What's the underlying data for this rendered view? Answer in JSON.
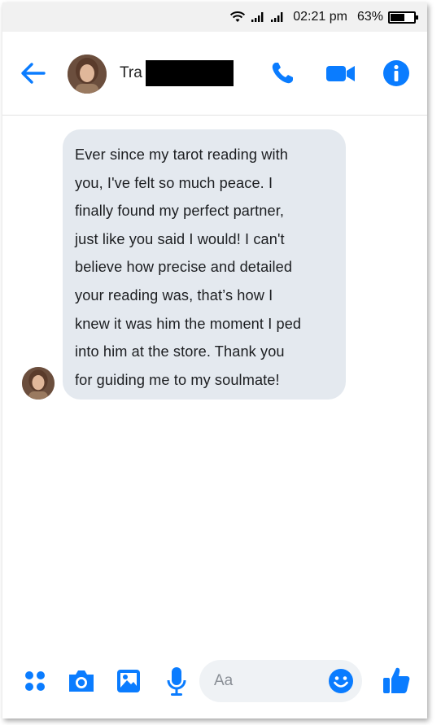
{
  "status_bar": {
    "time": "02:21 pm",
    "battery_percent": "63%",
    "battery_level": 0.63
  },
  "header": {
    "contact_name_visible": "Tra",
    "name_redacted": true,
    "icons": [
      "back-arrow-icon",
      "avatar",
      "phone-icon",
      "video-camera-icon",
      "info-icon"
    ]
  },
  "thread": {
    "messages": [
      {
        "direction": "incoming",
        "lines": [
          "Ever since my tarot reading with",
          "you, I've felt so much peace. I",
          "finally found my perfect partner,",
          "just like you said I would! I can't",
          "believe how precise and detailed",
          "your reading was, that’s how I",
          "knew it was him the moment I ped",
          "into him at the store. Thank you",
          "for guiding me to my soulmate!"
        ]
      }
    ]
  },
  "composer": {
    "placeholder": "Aa",
    "icons": [
      "apps-icon",
      "camera-icon",
      "gallery-icon",
      "microphone-icon",
      "emoji-icon",
      "thumbs-up-icon"
    ]
  },
  "colors": {
    "accent": "#0a7cff",
    "bubble_bg": "#e4e9ef",
    "status_bar_bg": "#f1f1f1",
    "input_bg": "#eff2f5"
  }
}
